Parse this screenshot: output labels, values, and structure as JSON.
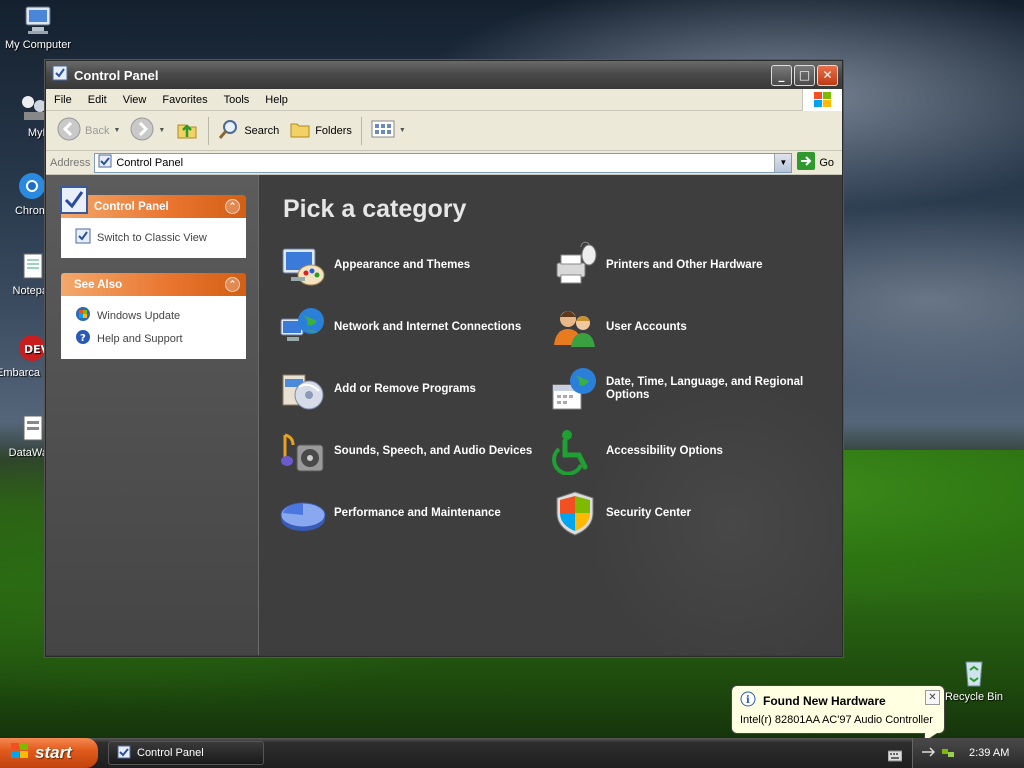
{
  "desktop": {
    "icons": [
      {
        "label": "My Computer"
      },
      {
        "label": "MyPa"
      },
      {
        "label": "Chrom"
      },
      {
        "label": "Notepa"
      },
      {
        "label": "Embarca Dev-C"
      },
      {
        "label": "DataWa"
      },
      {
        "label": "Recycle Bin"
      }
    ]
  },
  "window": {
    "title": "Control Panel",
    "menu": [
      "File",
      "Edit",
      "View",
      "Favorites",
      "Tools",
      "Help"
    ],
    "toolbar": {
      "back": "Back",
      "search": "Search",
      "folders": "Folders"
    },
    "address": {
      "label": "Address",
      "value": "Control Panel",
      "go": "Go"
    },
    "sidebar": {
      "panel1": {
        "title": "Control Panel",
        "items": [
          "Switch to Classic View"
        ]
      },
      "panel2": {
        "title": "See Also",
        "items": [
          "Windows Update",
          "Help and Support"
        ]
      }
    },
    "main": {
      "heading": "Pick a category",
      "categories": [
        {
          "label": "Appearance and Themes",
          "icon": "appearance-icon"
        },
        {
          "label": "Printers and Other Hardware",
          "icon": "printer-icon"
        },
        {
          "label": "Network and Internet Connections",
          "icon": "network-icon"
        },
        {
          "label": "User Accounts",
          "icon": "users-icon"
        },
        {
          "label": "Add or Remove Programs",
          "icon": "add-remove-icon"
        },
        {
          "label": "Date, Time, Language, and Regional Options",
          "icon": "date-time-icon"
        },
        {
          "label": "Sounds, Speech, and Audio Devices",
          "icon": "sound-icon"
        },
        {
          "label": "Accessibility Options",
          "icon": "accessibility-icon"
        },
        {
          "label": "Performance and Maintenance",
          "icon": "performance-icon"
        },
        {
          "label": "Security Center",
          "icon": "security-shield-icon"
        }
      ]
    }
  },
  "balloon": {
    "title": "Found New Hardware",
    "text": "Intel(r) 82801AA AC'97 Audio Controller"
  },
  "taskbar": {
    "start": "start",
    "task": "Control Panel",
    "clock": "2:39 AM"
  }
}
